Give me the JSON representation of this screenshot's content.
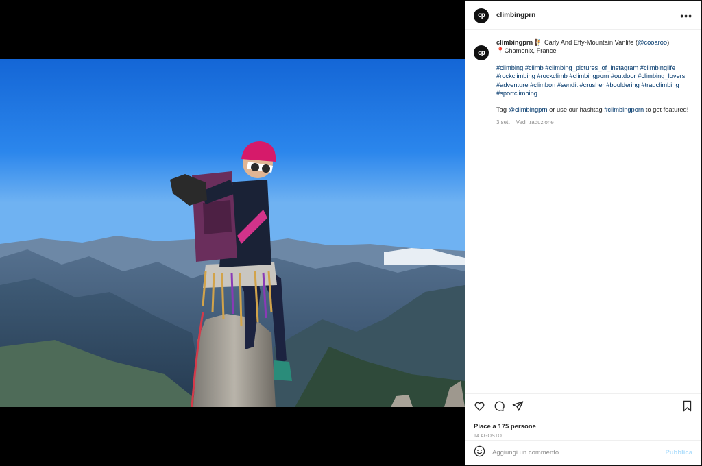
{
  "post": {
    "username": "climbingprn",
    "avatar_text": "cp",
    "more_label": "•••",
    "caption": {
      "username": "climbingprn",
      "emoji": "🧗",
      "title_text": " Carly And Effy-Mountain Vanlife (",
      "mention": "@cooaroo",
      "title_close": ")",
      "location_pin": "📍",
      "location": "Chamonix, France",
      "hashtags": "#climbing #climb #climbing_pictures_of_instagram #climbinglife #rockclimbing #rockclimb #climbingporn #outdoor #climbing_lovers #adventure #climbon #sendit #crusher #bouldering #tradclimbing #sportclimbing",
      "tag_prefix": "Tag ",
      "tag_mention": "@climbingprn",
      "tag_middle": " or use our hashtag ",
      "tag_hashtag": "#climbingporn",
      "tag_suffix": " to get featured!"
    },
    "meta": {
      "age": "3 sett",
      "translate": "Vedi traduzione"
    },
    "likes": "Piace a 175 persone",
    "date": "14 AGOSTO",
    "comment_placeholder": "Aggiungi un commento...",
    "publish_label": "Pubblica"
  },
  "icons": {
    "like": "heart-icon",
    "comment": "comment-icon",
    "share": "send-icon",
    "save": "bookmark-icon",
    "emoji": "smiley-icon",
    "more": "more-icon"
  },
  "colors": {
    "link": "#00376b",
    "muted": "#8e8e8e",
    "publish_disabled": "#b2dffc"
  }
}
